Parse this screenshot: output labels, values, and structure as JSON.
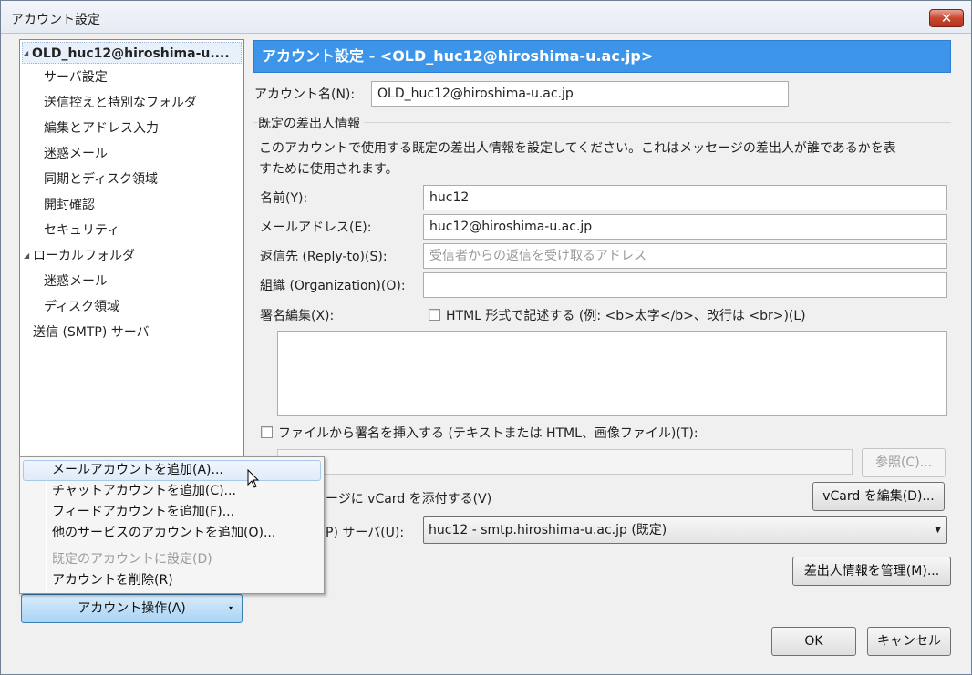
{
  "window": {
    "title": "アカウント設定",
    "close_symbol": "✕"
  },
  "tree": {
    "items": [
      {
        "label": "OLD_huc12@hiroshima-u...."
      },
      {
        "label": "サーバ設定"
      },
      {
        "label": "送信控えと特別なフォルダ"
      },
      {
        "label": "編集とアドレス入力"
      },
      {
        "label": "迷惑メール"
      },
      {
        "label": "同期とディスク領域"
      },
      {
        "label": "開封確認"
      },
      {
        "label": "セキュリティ"
      },
      {
        "label": "ローカルフォルダ"
      },
      {
        "label": "迷惑メール"
      },
      {
        "label": "ディスク領域"
      },
      {
        "label": "送信 (SMTP) サーバ"
      }
    ]
  },
  "panel": {
    "header": "アカウント設定 - <OLD_huc12@hiroshima-u.ac.jp>",
    "account_name_label": "アカウント名(N):",
    "account_name_value": "OLD_huc12@hiroshima-u.ac.jp",
    "identity_group_label": "既定の差出人情報",
    "identity_desc_1": "このアカウントで使用する既定の差出人情報を設定してください。これはメッセージの差出人が誰であるかを表",
    "identity_desc_2": "すために使用されます。",
    "name_label": "名前(Y):",
    "name_value": "huc12",
    "email_label": "メールアドレス(E):",
    "email_value": "huc12@hiroshima-u.ac.jp",
    "replyto_label": "返信先 (Reply-to)(S):",
    "replyto_placeholder": "受信者からの返信を受け取るアドレス",
    "org_label": "組織 (Organization)(O):",
    "org_value": "",
    "sig_label": "署名編集(X):",
    "html_sig_label": "HTML 形式で記述する (例: <b>太字</b>、改行は <br>)(L)",
    "file_sig_label": "ファイルから署名を挿入する (テキストまたは HTML、画像ファイル)(T):",
    "browse_button": "参照(C)...",
    "vcard_label": "ージに vCard を添付する(V)",
    "vcard_button": "vCard を編集(D)...",
    "smtp_label": "P) サーバ(U):",
    "smtp_value": "huc12 - smtp.hiroshima-u.ac.jp (既定)",
    "manage_identities_button": "差出人情報を管理(M)..."
  },
  "menu": {
    "items": [
      {
        "label": "メールアカウントを追加(A)...",
        "state": "hover"
      },
      {
        "label": "チャットアカウントを追加(C)...",
        "state": "normal"
      },
      {
        "label": "フィードアカウントを追加(F)...",
        "state": "normal"
      },
      {
        "label": "他のサービスのアカウントを追加(O)...",
        "state": "normal"
      },
      {
        "label": "既定のアカウントに設定(D)",
        "state": "disabled"
      },
      {
        "label": "アカウントを削除(R)",
        "state": "normal"
      }
    ]
  },
  "account_actions_button": "アカウント操作(A)",
  "footer": {
    "ok": "OK",
    "cancel": "キャンセル"
  }
}
